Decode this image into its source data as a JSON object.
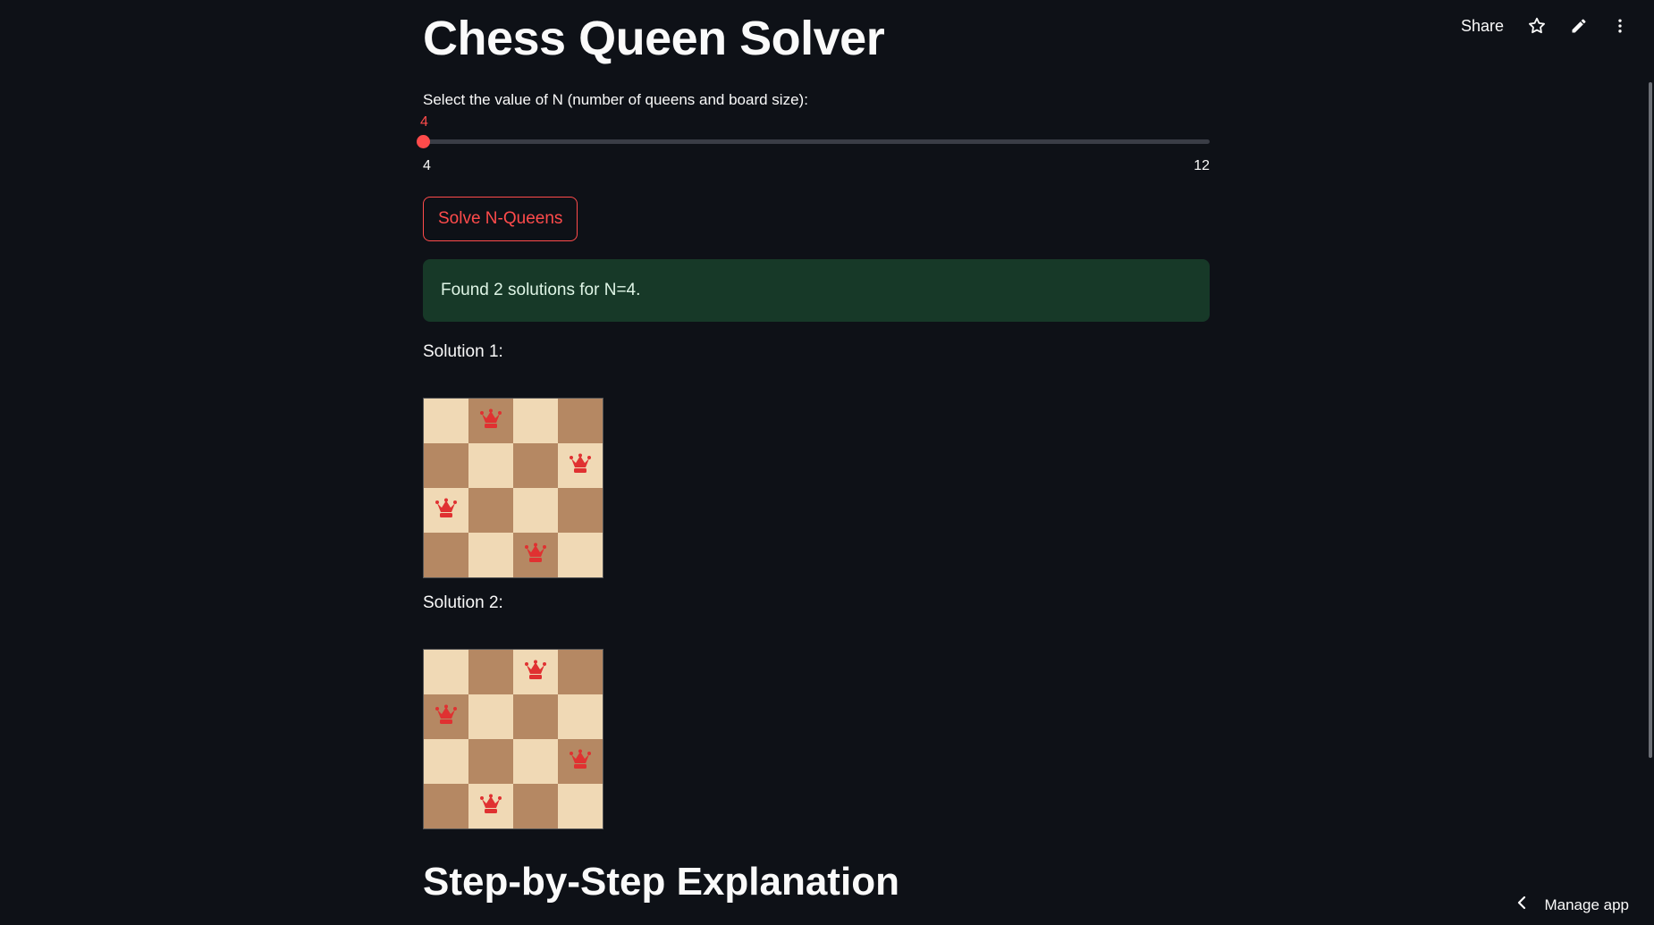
{
  "header": {
    "share_label": "Share",
    "icons": [
      "star-icon",
      "pencil-icon",
      "more-vertical-icon"
    ]
  },
  "main": {
    "title": "Chess Queen Solver",
    "slider": {
      "label": "Select the value of N (number of queens and board size):",
      "value": "4",
      "min": "4",
      "max": "12",
      "fill_fraction": 0
    },
    "solve_button_label": "Solve N-Queens",
    "success_message": "Found 2 solutions for N=4.",
    "solutions": [
      {
        "label": "Solution 1:",
        "queens": [
          1,
          3,
          0,
          2
        ]
      },
      {
        "label": "Solution 2:",
        "queens": [
          2,
          0,
          3,
          1
        ]
      }
    ],
    "section_title": "Step-by-Step Explanation"
  },
  "footer": {
    "manage_label": "Manage app"
  },
  "colors": {
    "background": "#0e1117",
    "accent": "#ff4b4b",
    "success_bg": "#173928",
    "light_square": "#f0d9b5",
    "dark_square": "#b58863",
    "queen": "#e03131"
  }
}
